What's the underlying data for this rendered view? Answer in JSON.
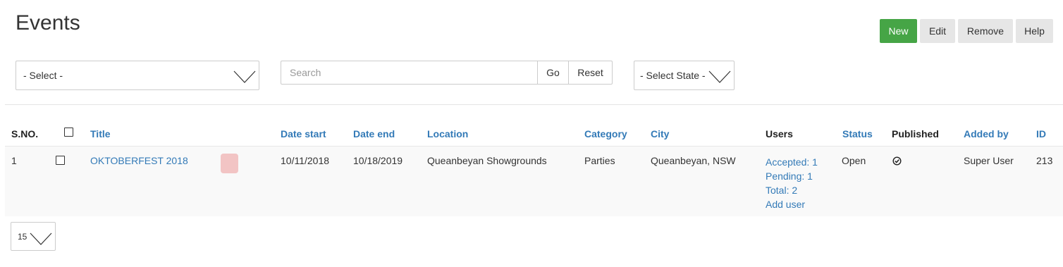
{
  "page": {
    "title": "Events"
  },
  "toolbar": {
    "new_label": "New",
    "edit_label": "Edit",
    "remove_label": "Remove",
    "help_label": "Help",
    "new_color": "#46a546"
  },
  "filters": {
    "select_label": "- Select -",
    "search_placeholder": "Search",
    "go_label": "Go",
    "reset_label": "Reset",
    "state_label": "- Select State -"
  },
  "table": {
    "headers": {
      "sno": "S.NO.",
      "title": "Title",
      "date_start": "Date start",
      "date_end": "Date end",
      "location": "Location",
      "category": "Category",
      "city": "City",
      "users": "Users",
      "status": "Status",
      "published": "Published",
      "added_by": "Added by",
      "id": "ID"
    },
    "rows": [
      {
        "sno": "1",
        "title": "OKTOBERFEST 2018",
        "color": "#f2c4c4",
        "date_start": "10/11/2018",
        "date_end": "10/18/2019",
        "location": "Queanbeyan Showgrounds",
        "category": "Parties",
        "city": "Queanbeyan, NSW",
        "users": {
          "accepted": "Accepted: 1",
          "pending": "Pending: 1",
          "total": "Total: 2",
          "add": "Add user"
        },
        "status": "Open",
        "published_icon": "check-circle-icon",
        "added_by": "Super User",
        "id": "213"
      }
    ]
  },
  "pagination": {
    "limit": "15"
  },
  "colors": {
    "link": "#337ab7",
    "row_bg": "#f9f9f9"
  }
}
